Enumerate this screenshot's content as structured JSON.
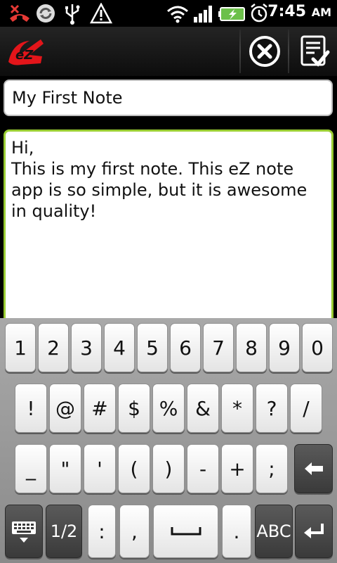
{
  "status_bar": {
    "time": "7:45",
    "ampm": "AM",
    "icons": [
      "missed-call-icon",
      "sync-icon",
      "usb-icon",
      "warning-icon",
      "wifi-icon",
      "signal-icon",
      "battery-charging-icon",
      "alarm-icon"
    ]
  },
  "action_bar": {
    "logo_text": "eZ",
    "buttons": [
      "cancel-icon",
      "save-checklist-icon"
    ]
  },
  "note": {
    "title": "My First Note",
    "body": "Hi,\nThis is my first note. This eZ note app is so simple, but it is awesome in quality!"
  },
  "keyboard": {
    "row1": [
      "1",
      "2",
      "3",
      "4",
      "5",
      "6",
      "7",
      "8",
      "9",
      "0"
    ],
    "row2": [
      "!",
      "@",
      "#",
      "$",
      "%",
      "&",
      "*",
      "?",
      "/"
    ],
    "row3": [
      "_",
      "\"",
      "'",
      "(",
      ")",
      "-",
      "+",
      ";"
    ],
    "row4": {
      "page": "1/2",
      "colon": ":",
      "comma": ",",
      "period": ".",
      "abc": "ABC"
    }
  }
}
